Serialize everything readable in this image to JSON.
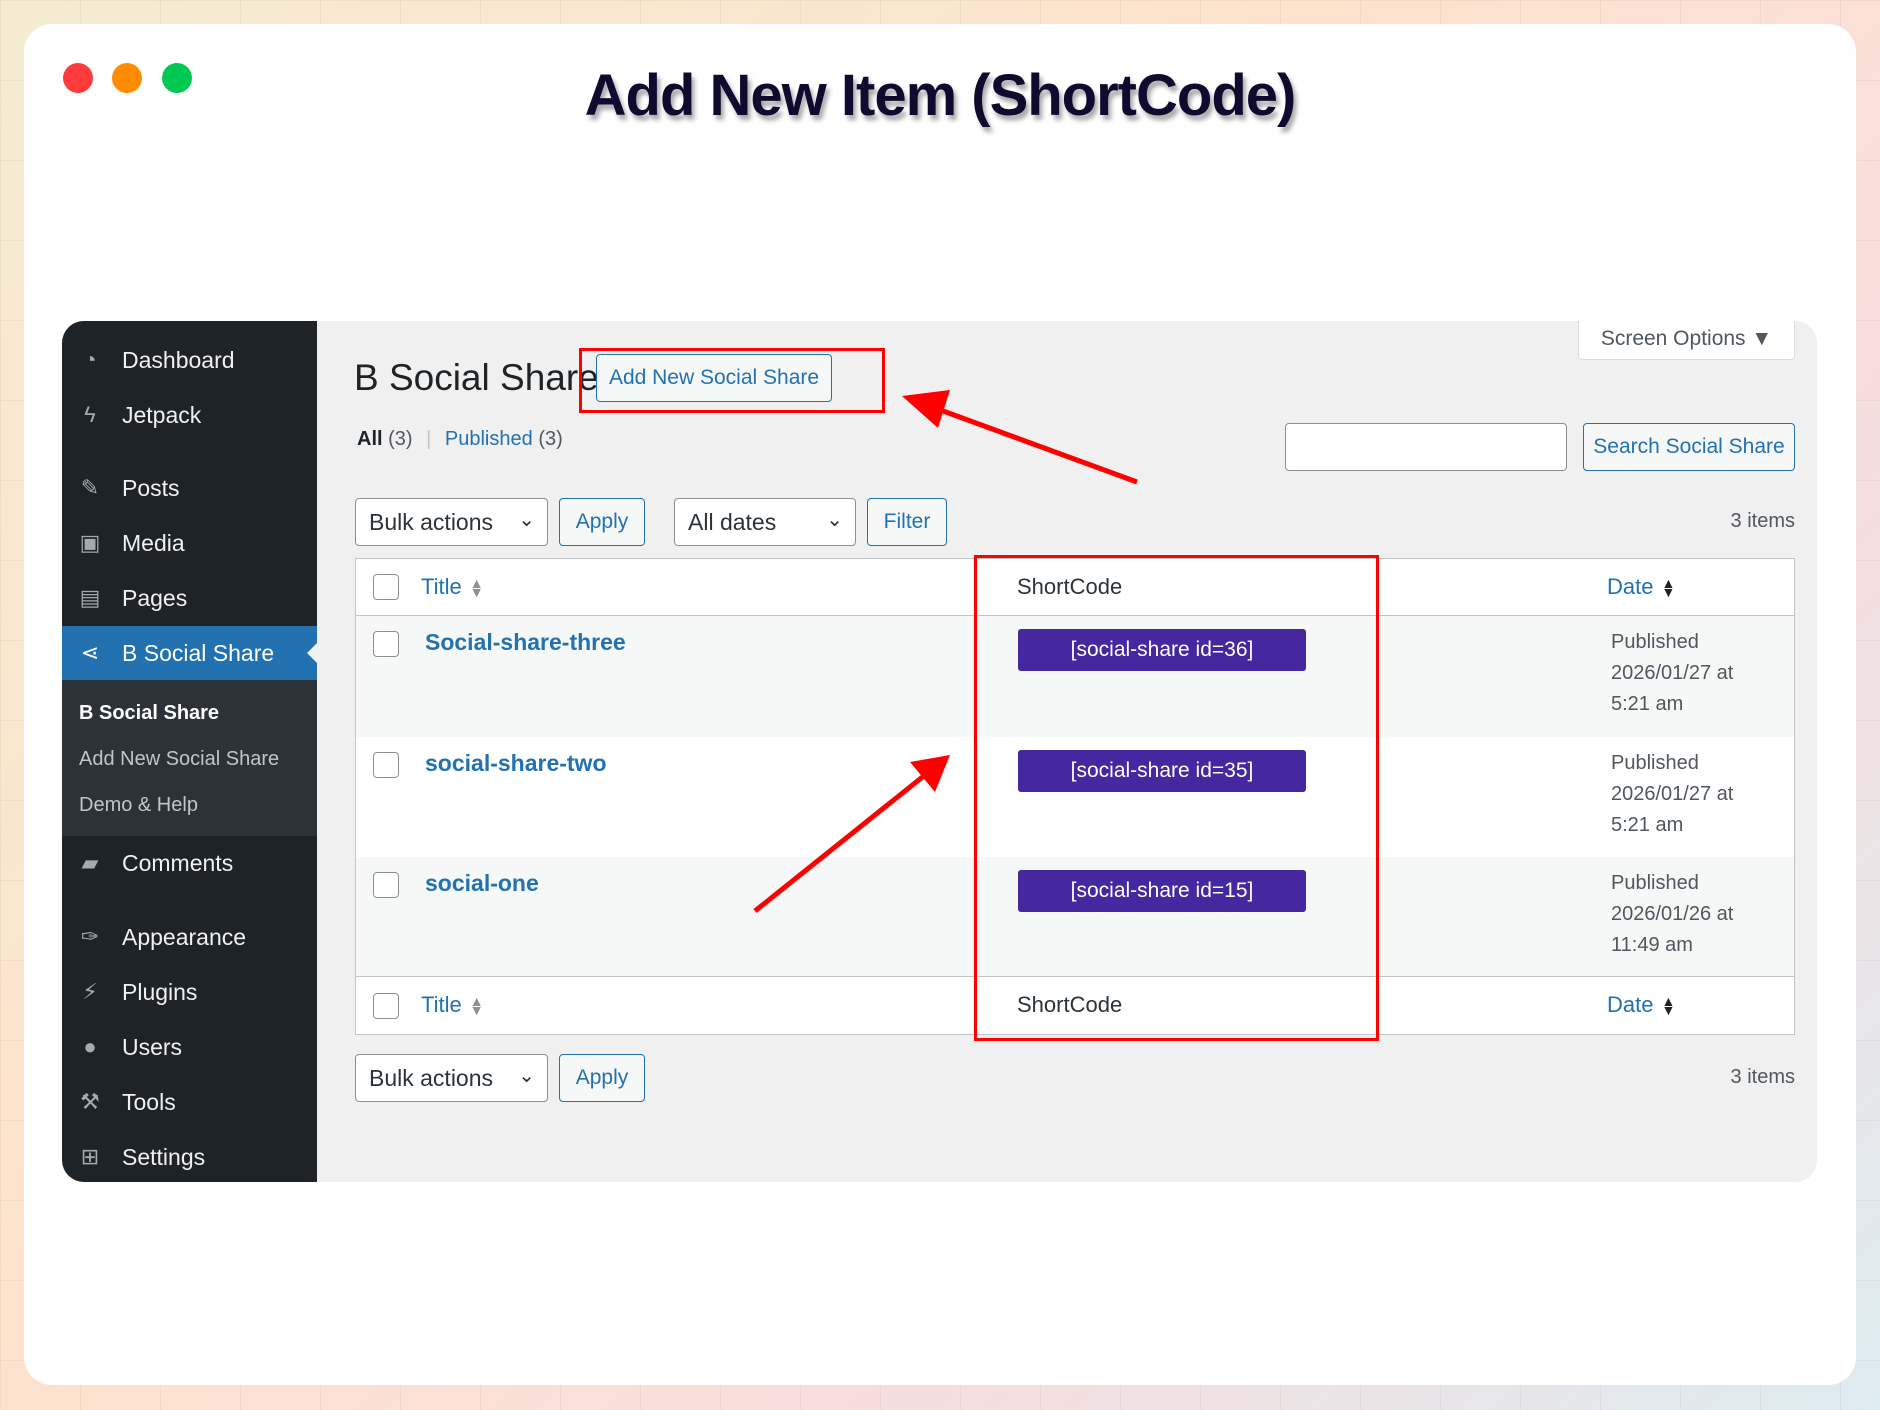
{
  "heading": "Add New Item (ShortCode)",
  "colors": {
    "red_dot": "#ff3b3b",
    "orange_dot": "#ff8c00",
    "green_dot": "#00c853",
    "accent": "#2271b1",
    "badge": "#4527a0",
    "annotation": "#ff0000"
  },
  "sidebar": {
    "items": [
      {
        "label": "Dashboard",
        "icon": "dashboard-icon"
      },
      {
        "label": "Jetpack",
        "icon": "jetpack-icon"
      },
      {
        "label": "Posts",
        "icon": "pin-icon"
      },
      {
        "label": "Media",
        "icon": "media-icon"
      },
      {
        "label": "Pages",
        "icon": "pages-icon"
      },
      {
        "label": "B Social Share",
        "icon": "share-icon"
      },
      {
        "label": "Comments",
        "icon": "comment-icon"
      },
      {
        "label": "Appearance",
        "icon": "brush-icon"
      },
      {
        "label": "Plugins",
        "icon": "plugin-icon"
      },
      {
        "label": "Users",
        "icon": "user-icon"
      },
      {
        "label": "Tools",
        "icon": "wrench-icon"
      },
      {
        "label": "Settings",
        "icon": "settings-icon"
      }
    ],
    "submenu": [
      "B Social Share",
      "Add New Social Share",
      "Demo & Help"
    ]
  },
  "page": {
    "title": "B Social Share",
    "add_new": "Add New Social Share",
    "screen_options": "Screen Options ▼",
    "filters": {
      "all": "All",
      "all_count": "(3)",
      "sep": "|",
      "published": "Published",
      "published_count": "(3)"
    },
    "search_value": "",
    "search_button": "Search Social Share",
    "bulk_actions": "Bulk actions",
    "apply": "Apply",
    "all_dates": "All dates",
    "filter": "Filter",
    "items_count": "3 items"
  },
  "table": {
    "columns": {
      "title": "Title",
      "shortcode": "ShortCode",
      "date": "Date"
    },
    "rows": [
      {
        "title": "Social-share-three",
        "shortcode": "[social-share id=36]",
        "status": "Published",
        "date": "2026/01/27 at",
        "time": "5:21 am"
      },
      {
        "title": "social-share-two",
        "shortcode": "[social-share id=35]",
        "status": "Published",
        "date": "2026/01/27 at",
        "time": "5:21 am"
      },
      {
        "title": "social-one",
        "shortcode": "[social-share id=15]",
        "status": "Published",
        "date": "2026/01/26 at",
        "time": "11:49 am"
      }
    ]
  }
}
